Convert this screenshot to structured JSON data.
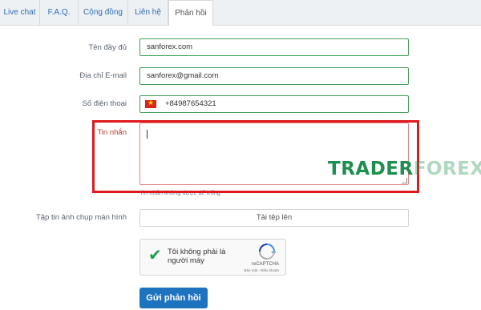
{
  "tabs": [
    {
      "label": "Live chat"
    },
    {
      "label": "F.A.Q."
    },
    {
      "label": "Cộng đồng"
    },
    {
      "label": "Liên hệ"
    },
    {
      "label": "Phản hồi"
    }
  ],
  "form": {
    "name_label": "Tên đầy đủ",
    "name_value": "sanforex.com",
    "email_label": "Địa chỉ E-mail",
    "email_value": "sanforex@gmail.com",
    "phone_label": "Số điện thoại",
    "phone_value": "+84987654321",
    "phone_flag": "vn-flag-icon",
    "message_label": "Tin nhắn",
    "message_error": "Tin nhắn không được để trống",
    "attachment_label": "Tập tin ảnh chụp màn hình",
    "upload_label": "Tải tệp lên",
    "captcha_text": "Tôi không phải là người máy",
    "captcha_brand": "reCAPTCHA",
    "captcha_terms": "Bảo mật - Điều khoản",
    "submit_label": "Gửi phản hồi"
  },
  "watermark": {
    "part1": "TRADER",
    "part2": "FOREX"
  },
  "colors": {
    "accent": "#1e73be",
    "field_border": "#3f9d5a",
    "error": "#c0392b",
    "highlight": "#e0191e"
  }
}
